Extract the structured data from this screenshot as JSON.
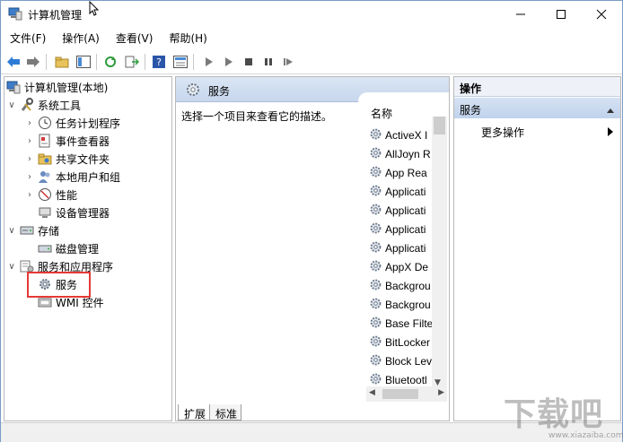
{
  "window": {
    "title": "计算机管理"
  },
  "menu": [
    {
      "label": "文件(F)"
    },
    {
      "label": "操作(A)"
    },
    {
      "label": "查看(V)"
    },
    {
      "label": "帮助(H)"
    }
  ],
  "tree": {
    "root": "计算机管理(本地)",
    "system_tools": "系统工具",
    "task_scheduler": "任务计划程序",
    "event_viewer": "事件查看器",
    "shared_folders": "共享文件夹",
    "local_users": "本地用户和组",
    "performance": "性能",
    "device_manager": "设备管理器",
    "storage": "存储",
    "disk_management": "磁盘管理",
    "services_apps": "服务和应用程序",
    "services": "服务",
    "wmi": "WMI 控件"
  },
  "middle": {
    "header": "服务",
    "description": "选择一个项目来查看它的描述。",
    "column_name": "名称",
    "services": [
      "ActiveX I",
      "AllJoyn R",
      "App Rea",
      "Applicati",
      "Applicati",
      "Applicati",
      "Applicati",
      "AppX De",
      "Backgrou",
      "Backgrou",
      "Base Filte",
      "BitLocker",
      "Block Lev",
      "Bluetootl"
    ],
    "tabs": [
      "扩展",
      "标准"
    ]
  },
  "actions": {
    "header": "操作",
    "section": "服务",
    "more": "更多操作"
  },
  "watermark": {
    "main": "下载吧",
    "sub": "www.xiazaiba.com"
  },
  "colors": {
    "highlight": "#e53935",
    "header_blue": "#c6d6ec"
  }
}
